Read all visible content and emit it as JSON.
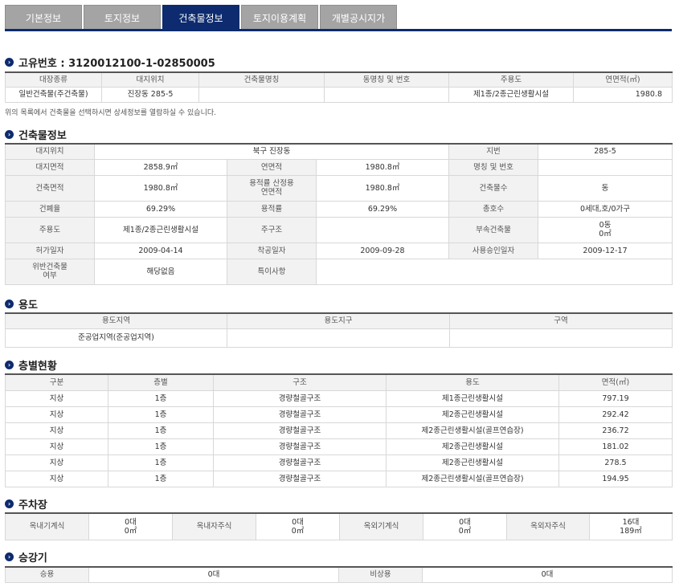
{
  "tabs": [
    {
      "label": "기본정보",
      "active": false
    },
    {
      "label": "토지정보",
      "active": false
    },
    {
      "label": "건축물정보",
      "active": true
    },
    {
      "label": "토지이용계획",
      "active": false
    },
    {
      "label": "개별공시지가",
      "active": false
    }
  ],
  "unique": {
    "title": "고유번호 : 3120012100-1-02850005",
    "headers": [
      "대장종류",
      "대지위치",
      "건축물명칭",
      "동명칭 및 번호",
      "주용도",
      "연면적(㎡)"
    ],
    "row": [
      "일반건축물(주건축물)",
      "진장동 285-5",
      "",
      "",
      "제1종/2종근린생활시설",
      "1980.8"
    ],
    "note": "위의 목록에서 건축물을 선택하시면 상세정보를 열람하실 수 있습니다."
  },
  "building": {
    "title": "건축물정보",
    "lbl_location": "대지위치",
    "val_location": "북구 진장동",
    "lbl_jibun": "지번",
    "val_jibun": "285-5",
    "lbl_site_area": "대지면적",
    "val_site_area": "2858.9㎡",
    "lbl_total_area": "연면적",
    "val_total_area": "1980.8㎡",
    "lbl_name_no": "명칭 및 번호",
    "val_name_no": "",
    "lbl_build_area": "건축면적",
    "val_build_area": "1980.8㎡",
    "lbl_far_area_1": "용적률 산정용",
    "lbl_far_area_2": "연면적",
    "val_far_area": "1980.8㎡",
    "lbl_bldg_count": "건축물수",
    "val_bldg_count": "동",
    "lbl_bcr": "건폐율",
    "val_bcr": "69.29%",
    "lbl_far": "용적률",
    "val_far": "69.29%",
    "lbl_units": "총호수",
    "val_units": "0세대,호/0가구",
    "lbl_main_use": "주용도",
    "val_main_use": "제1종/2종근린생활시설",
    "lbl_structure": "주구조",
    "val_structure": "",
    "lbl_annex": "부속건축물",
    "val_annex_1": "0동",
    "val_annex_2": "0㎡",
    "lbl_permit": "허가일자",
    "val_permit": "2009-04-14",
    "lbl_start": "착공일자",
    "val_start": "2009-09-28",
    "lbl_approval": "사용승인일자",
    "val_approval": "2009-12-17",
    "lbl_illegal_1": "위반건축물",
    "lbl_illegal_2": "여부",
    "val_illegal": "해당없음",
    "lbl_special": "특이사항",
    "val_special": ""
  },
  "usage": {
    "title": "용도",
    "headers": [
      "용도지역",
      "용도지구",
      "구역"
    ],
    "row": [
      "준공업지역(준공업지역)",
      "",
      ""
    ]
  },
  "floors": {
    "title": "층별현황",
    "headers": [
      "구분",
      "층별",
      "구조",
      "용도",
      "면적(㎡)"
    ],
    "rows": [
      [
        "지상",
        "1층",
        "경량철골구조",
        "제1종근린생활시설",
        "797.19"
      ],
      [
        "지상",
        "1층",
        "경량철골구조",
        "제2종근린생활시설",
        "292.42"
      ],
      [
        "지상",
        "1층",
        "경량철골구조",
        "제2종근린생활시설(골프연습장)",
        "236.72"
      ],
      [
        "지상",
        "1층",
        "경량철골구조",
        "제2종근린생활시설",
        "181.02"
      ],
      [
        "지상",
        "1층",
        "경량철골구조",
        "제2종근린생활시설",
        "278.5"
      ],
      [
        "지상",
        "1층",
        "경량철골구조",
        "제2종근린생활시설(골프연습장)",
        "194.95"
      ]
    ]
  },
  "parking": {
    "title": "주차장",
    "items": [
      {
        "label": "옥내기계식",
        "count": "0대",
        "area": "0㎡"
      },
      {
        "label": "옥내자주식",
        "count": "0대",
        "area": "0㎡"
      },
      {
        "label": "옥외기계식",
        "count": "0대",
        "area": "0㎡"
      },
      {
        "label": "옥외자주식",
        "count": "16대",
        "area": "189㎡"
      }
    ]
  },
  "elevator": {
    "title": "승강기",
    "passenger_label": "승용",
    "passenger_value": "0대",
    "emergency_label": "비상용",
    "emergency_value": "0대"
  }
}
